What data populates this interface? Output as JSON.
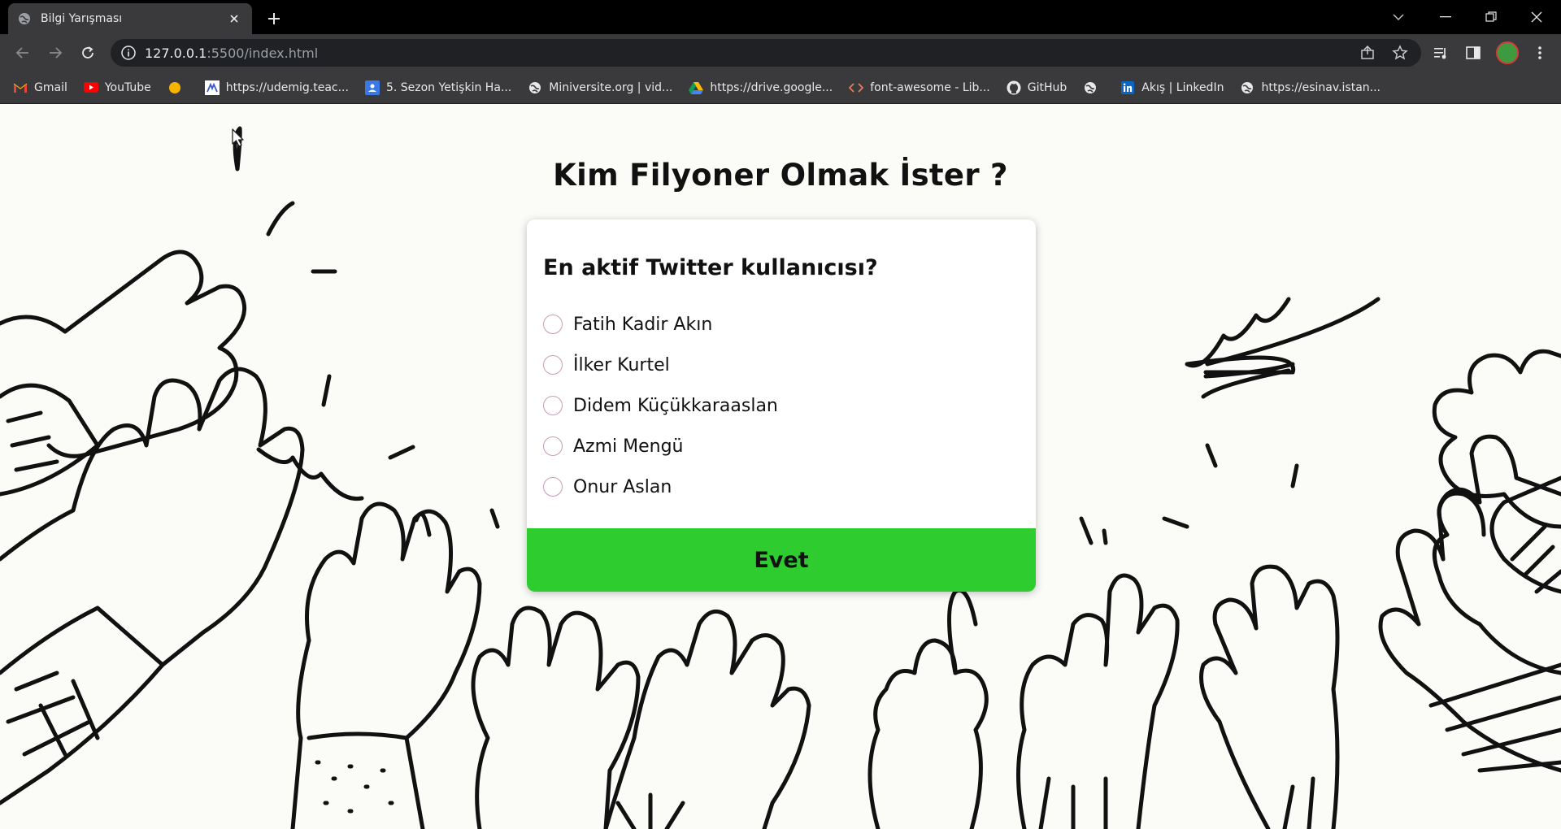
{
  "browser": {
    "tab_title": "Bilgi Yarışması",
    "url_host": "127.0.0.1",
    "url_rest": ":5500/index.html",
    "bookmarks": [
      {
        "label": "Gmail",
        "icon": "gmail-icon"
      },
      {
        "label": "YouTube",
        "icon": "youtube-icon"
      },
      {
        "label": "",
        "icon": "yellow-dot-icon"
      },
      {
        "label": "https://udemig.teac...",
        "icon": "udemig-icon"
      },
      {
        "label": "5. Sezon Yetişkin Ha...",
        "icon": "classroom-icon"
      },
      {
        "label": "Miniversite.org | vid...",
        "icon": "globe-icon"
      },
      {
        "label": "https://drive.google...",
        "icon": "drive-icon"
      },
      {
        "label": "font-awesome - Lib...",
        "icon": "code-icon"
      },
      {
        "label": "GitHub",
        "icon": "github-icon"
      },
      {
        "label": "",
        "icon": "globe-icon"
      },
      {
        "label": "Akış | LinkedIn",
        "icon": "linkedin-icon"
      },
      {
        "label": "https://esinav.istan...",
        "icon": "globe-icon"
      }
    ]
  },
  "page": {
    "title": "Kim Filyoner Olmak İster ?"
  },
  "quiz": {
    "question": "En aktif Twitter kullanıcısı?",
    "answers": [
      "Fatih Kadir Akın",
      "İlker Kurtel",
      "Didem Küçükkaraaslan",
      "Azmi Mengü",
      "Onur Aslan"
    ],
    "submit_label": "Evet",
    "submit_color": "#2ecc2e",
    "radio_color": "#c99ab6"
  }
}
